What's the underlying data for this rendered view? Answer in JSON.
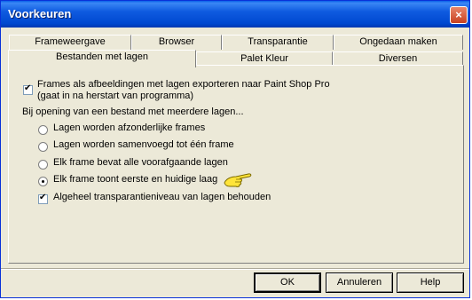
{
  "window": {
    "title": "Voorkeuren",
    "close_glyph": "×"
  },
  "tabs_back": [
    "Frameweergave",
    "Browser",
    "Transparantie",
    "Ongedaan maken"
  ],
  "tabs_front": [
    "Bestanden met lagen",
    "Palet Kleur",
    "Diversen"
  ],
  "active_tab": "Bestanden met lagen",
  "options": {
    "export_line1": "Frames als afbeeldingen met lagen exporteren naar Paint Shop Pro",
    "export_line2": "(gaat in na herstart van programma)",
    "export_checked": true,
    "opening_label": "Bij opening van een bestand met meerdere lagen...",
    "radio": [
      {
        "label": "Lagen worden afzonderlijke frames",
        "selected": false
      },
      {
        "label": "Lagen worden samenvoegd tot één frame",
        "selected": false
      },
      {
        "label": "Elk frame bevat alle voorafgaande lagen",
        "selected": false
      },
      {
        "label": "Elk frame toont eerste en huidige laag",
        "selected": true
      }
    ],
    "transparency_label": "Algeheel transparantieniveau van lagen behouden",
    "transparency_checked": true
  },
  "buttons": {
    "ok": "OK",
    "cancel": "Annuleren",
    "help": "Help"
  },
  "icons": {
    "pointer": "pointing-hand-icon"
  }
}
